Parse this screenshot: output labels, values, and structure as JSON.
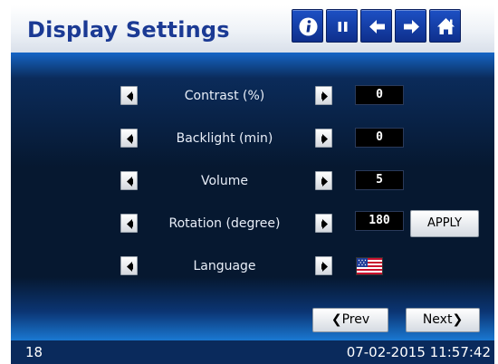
{
  "header": {
    "title": "Display Settings",
    "buttons": [
      {
        "name": "info",
        "icon": "info-icon"
      },
      {
        "name": "pause",
        "icon": "pause-icon"
      },
      {
        "name": "back",
        "icon": "arrow-left-icon"
      },
      {
        "name": "forward",
        "icon": "arrow-right-icon"
      },
      {
        "name": "home",
        "icon": "home-icon"
      }
    ]
  },
  "settings": [
    {
      "label": "Contrast (%)",
      "value": "0"
    },
    {
      "label": "Backlight (min)",
      "value": "0"
    },
    {
      "label": "Volume",
      "value": "5"
    },
    {
      "label": "Rotation (degree)",
      "value": "180"
    },
    {
      "label": "Language",
      "value_icon": "us-flag-icon"
    }
  ],
  "apply_label": "APPLY",
  "nav": {
    "prev_label": "Prev",
    "next_label": "Next"
  },
  "status": {
    "left": "18",
    "datetime": "07-02-2015 11:57:42"
  },
  "colors": {
    "title": "#1b3a94",
    "header_button": "#0e2f8c",
    "panel_dark": "#061830",
    "panel_light": "#1a78d2",
    "status_bar": "#0a2a5c"
  }
}
